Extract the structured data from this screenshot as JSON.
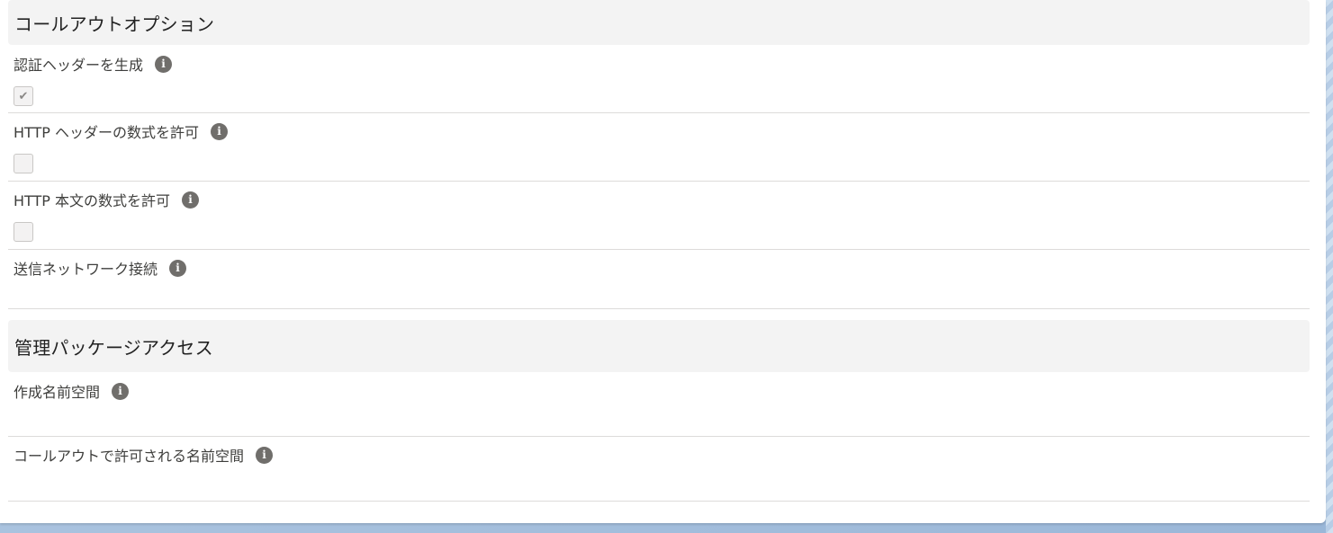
{
  "sections": [
    {
      "title": "コールアウトオプション",
      "fields": [
        {
          "label": "認証ヘッダーを生成",
          "checked": true
        },
        {
          "label": "HTTP ヘッダーの数式を許可",
          "checked": false
        },
        {
          "label": "HTTP 本文の数式を許可",
          "checked": false
        },
        {
          "label": "送信ネットワーク接続",
          "value": ""
        }
      ]
    },
    {
      "title": "管理パッケージアクセス",
      "fields": [
        {
          "label": "作成名前空間",
          "value": ""
        },
        {
          "label": "コールアウトで許可される名前空間",
          "value": ""
        }
      ]
    }
  ],
  "icons": {
    "info": "info-icon",
    "check": "checkmark-icon"
  },
  "glyphs": {
    "info": "i",
    "check": "✔"
  }
}
